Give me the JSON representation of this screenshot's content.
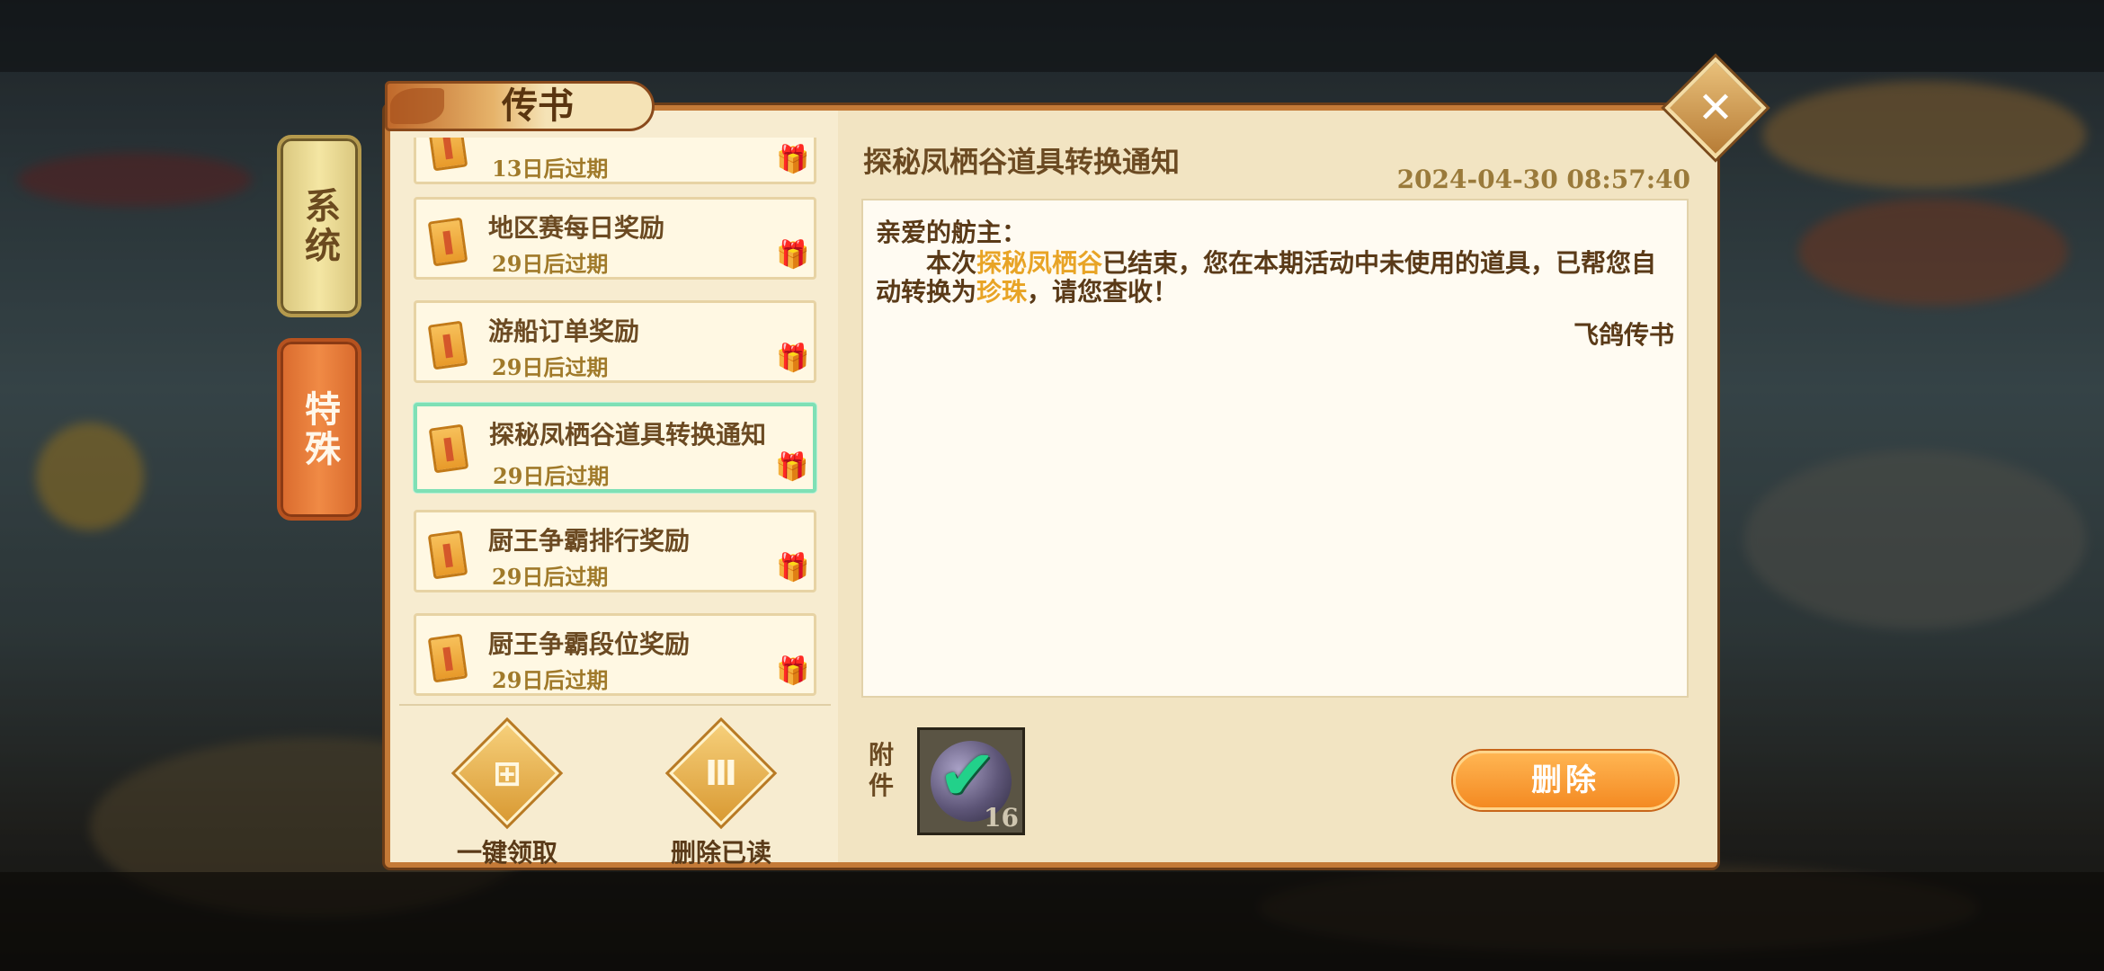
{
  "side_tabs": [
    {
      "label": "系统"
    },
    {
      "label": "特殊"
    }
  ],
  "panel": {
    "title": "传书",
    "close_icon": "close-icon"
  },
  "mail_list": [
    {
      "name": "",
      "expiry": "13日后过期"
    },
    {
      "name": "地区赛每日奖励",
      "expiry": "29日后过期"
    },
    {
      "name": "游船订单奖励",
      "expiry": "29日后过期"
    },
    {
      "name": "探秘凤栖谷道具转换通知",
      "expiry": "29日后过期",
      "selected": true
    },
    {
      "name": "厨王争霸排行奖励",
      "expiry": "29日后过期"
    },
    {
      "name": "厨王争霸段位奖励",
      "expiry": "29日后过期"
    }
  ],
  "actions": {
    "claim_all": "一键领取",
    "delete_read": "删除已读"
  },
  "message": {
    "title": "探秘凤栖谷道具转换通知",
    "date": "2024-04-30  08:57:40",
    "greeting": "亲爱的舫主：",
    "body_part1": "本次",
    "highlight1": "探秘凤栖谷",
    "body_part2": "已结束，您在本期活动中未使用的道具，已帮您自动转换为",
    "highlight2": "珍珠",
    "body_part3": "，请您查收！",
    "signature": "飞鸽传书"
  },
  "attachment": {
    "label": "附件",
    "quantity": "16"
  },
  "delete_button": "删除",
  "colors": {
    "highlight": "#e8a426",
    "selected_border": "#7ee0b5",
    "accent_orange": "#f48a22"
  }
}
